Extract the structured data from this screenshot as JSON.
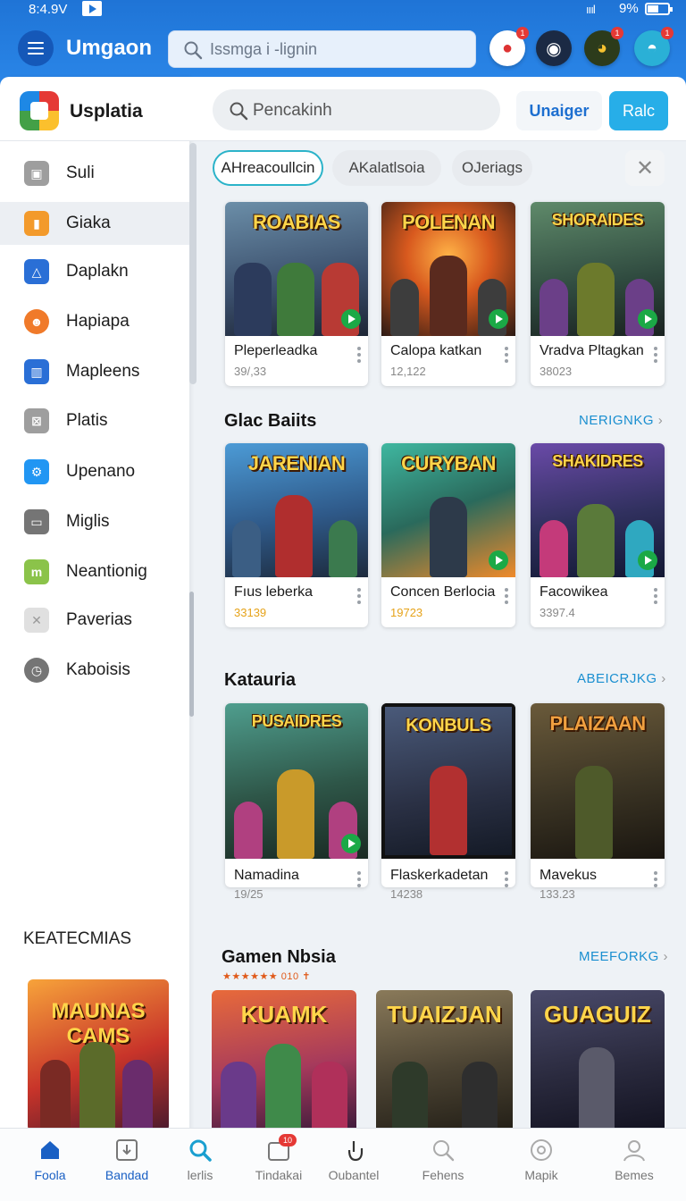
{
  "status_bar": {
    "time": "8:4.9V",
    "signal": "ıııl",
    "battery": "9%"
  },
  "app_bar": {
    "title": "Umgaon",
    "search_placeholder": "Issmga i -lignin",
    "badges": [
      "1",
      "",
      "1",
      "1"
    ]
  },
  "sidebar": {
    "brand": "Usplatia",
    "items": [
      {
        "label": "Suli",
        "icon": "calendar-icon",
        "color": "#9e9e9e"
      },
      {
        "label": "Giaka",
        "icon": "flag-icon",
        "color": "#f39a2b"
      },
      {
        "label": "Daplakn",
        "icon": "triangle-icon",
        "color": "#2a6fd6"
      },
      {
        "label": "Hapiapa",
        "icon": "runner-icon",
        "color": "#f07a2a"
      },
      {
        "label": "Mapleens",
        "icon": "building-icon",
        "color": "#2a6fd6"
      },
      {
        "label": "Platis",
        "icon": "chart-icon",
        "color": "#9e9e9e"
      },
      {
        "label": "Upenano",
        "icon": "gear-icon",
        "color": "#2196f3"
      },
      {
        "label": "Miglis",
        "icon": "window-icon",
        "color": "#757575"
      },
      {
        "label": "Neantionig",
        "icon": "m-icon",
        "color": "#8bc34a"
      },
      {
        "label": "Paverias",
        "icon": "close-box-icon",
        "color": "#bdbdbd"
      },
      {
        "label": "Kaboisis",
        "icon": "clock-icon",
        "color": "#757575"
      }
    ],
    "section_title": "KEATECMIAS",
    "promo_title": "MAUNAS CAMS"
  },
  "main_header": {
    "search_placeholder": "Pencakinh",
    "outline_button": "Unaiger",
    "solid_button": "Ralc"
  },
  "chips": [
    "AHreacoullcin",
    "AKalatlsoia",
    "OJeriags"
  ],
  "rows": [
    {
      "title": "",
      "more": "",
      "cards": [
        {
          "art": "ROABIAS",
          "name": "Pleperleadka",
          "meta": "39/,33"
        },
        {
          "art": "POLENAN",
          "name": "Calopa katkan",
          "meta": "12,122"
        },
        {
          "art": "SHORAIDES",
          "name": "Vradva Pltagkan",
          "meta": "38023"
        }
      ]
    },
    {
      "title": "Glac Baiits",
      "more": "NERIGNKG",
      "cards": [
        {
          "art": "JARENIAN",
          "name": "Fıus leberka",
          "meta": "33139"
        },
        {
          "art": "CURYBAN",
          "name": "Concen Berlocia",
          "meta": "19723"
        },
        {
          "art": "SHAKIDRES",
          "name": "Facowikea",
          "meta": "3397.4"
        }
      ]
    },
    {
      "title": "Katauria",
      "more": "ABEICRJKG",
      "cards": [
        {
          "art": "PUSAIDRES",
          "name": "Namadina",
          "meta": "19/25"
        },
        {
          "art": "KONBULS",
          "name": "Flaskerkadetan",
          "meta": "14238"
        },
        {
          "art": "PLAIZAAN",
          "name": "Mavekus",
          "meta": "133.23"
        }
      ]
    },
    {
      "title": "Gamen Nbsia",
      "more": "MEEFORKG",
      "stars": "★★★★★★ 010 ✝",
      "cards": [
        {
          "art": "KUAMK"
        },
        {
          "art": "TUAIZJAN"
        },
        {
          "art": "GUAGUIZ"
        }
      ]
    }
  ],
  "bottom_nav": [
    {
      "label": "Foola",
      "icon": "home-icon"
    },
    {
      "label": "Bandad",
      "icon": "download-icon"
    },
    {
      "label": "lerlis",
      "icon": "search-icon"
    },
    {
      "label": "Tindakai",
      "icon": "inbox-icon",
      "badge": "10"
    },
    {
      "label": "Oubantel",
      "icon": "touch-icon"
    },
    {
      "label": "Fehens",
      "icon": "search-icon"
    },
    {
      "label": "Mapik",
      "icon": "compass-icon"
    },
    {
      "label": "Bemes",
      "icon": "profile-icon"
    }
  ]
}
